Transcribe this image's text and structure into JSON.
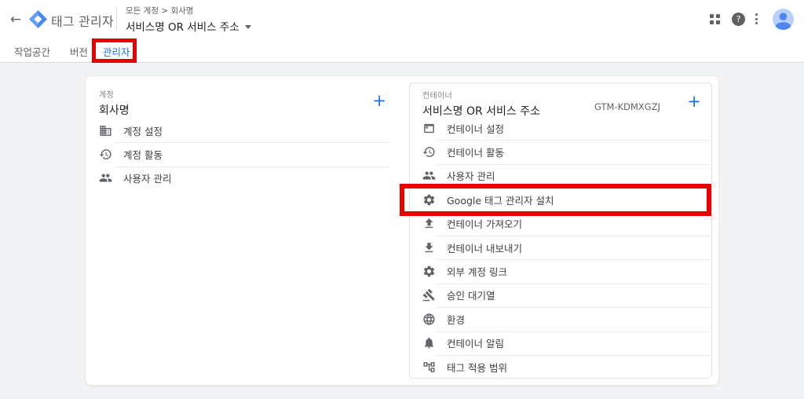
{
  "header": {
    "back_glyph": "←",
    "app_title": "태그 관리자",
    "breadcrumb": "모든 계정 > 회사명",
    "container_selector": "서비스명 OR 서비스 주소",
    "help_glyph": "?"
  },
  "tabs": [
    {
      "label": "작업공간",
      "active": false
    },
    {
      "label": "버전",
      "active": false
    },
    {
      "label": "관리자",
      "active": true,
      "annotated": true
    }
  ],
  "account_card": {
    "section_label": "계정",
    "title": "회사명",
    "add_label": "+",
    "items": [
      {
        "icon": "building",
        "label": "계정 설정"
      },
      {
        "icon": "history",
        "label": "계정 활동"
      },
      {
        "icon": "people",
        "label": "사용자 관리"
      }
    ]
  },
  "container_card": {
    "section_label": "컨테이너",
    "title": "서비스명 OR 서비스 주소",
    "container_id": "GTM-KDMXGZJ",
    "add_label": "+",
    "items": [
      {
        "icon": "web-asset",
        "label": "컨테이너 설정"
      },
      {
        "icon": "history",
        "label": "컨테이너 활동"
      },
      {
        "icon": "people",
        "label": "사용자 관리"
      },
      {
        "icon": "gear",
        "label": "Google 태그 관리자 설치",
        "annotated": true
      },
      {
        "icon": "upload",
        "label": "컨테이너 가져오기"
      },
      {
        "icon": "download",
        "label": "컨테이너 내보내기"
      },
      {
        "icon": "gear",
        "label": "외부 계정 링크"
      },
      {
        "icon": "gavel",
        "label": "승인 대기열"
      },
      {
        "icon": "globe",
        "label": "환경"
      },
      {
        "icon": "bell",
        "label": "컨테이너 알림"
      },
      {
        "icon": "sitemap",
        "label": "태그 적용 범위"
      }
    ]
  },
  "colors": {
    "accent_blue": "#1a73e8",
    "annotation_red": "#e80000",
    "icon_gray": "#5f6368",
    "page_background": "#f1f3f4"
  }
}
